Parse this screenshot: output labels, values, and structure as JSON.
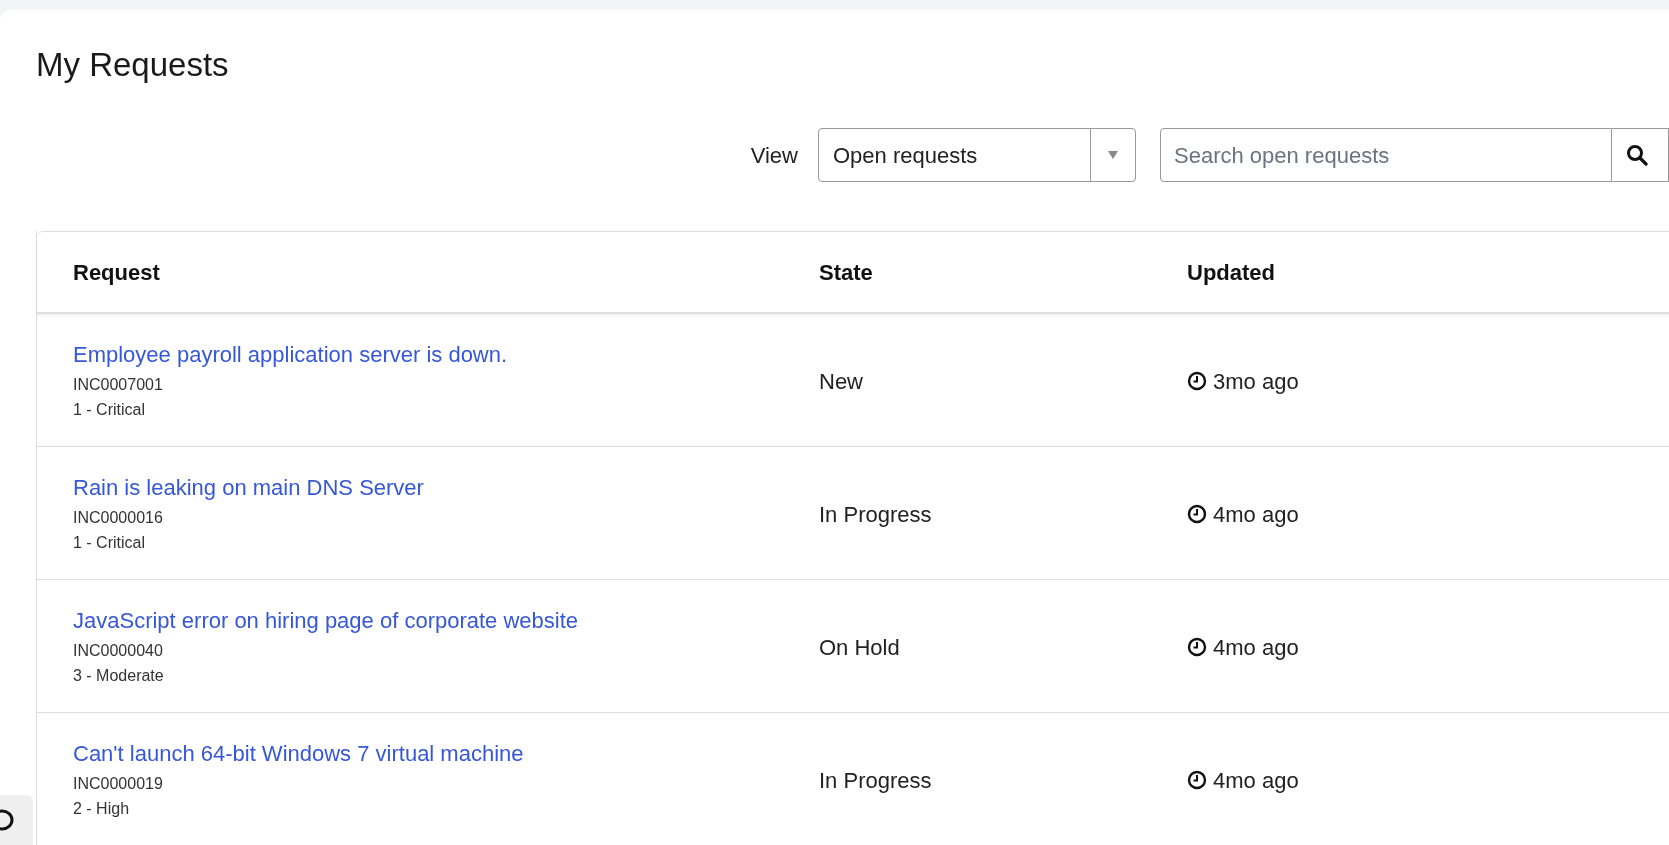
{
  "page": {
    "title": "My Requests"
  },
  "filters": {
    "view_label": "View",
    "view_value": "Open requests",
    "search_placeholder": "Search open requests"
  },
  "table": {
    "columns": [
      "Request",
      "State",
      "Updated"
    ],
    "rows": [
      {
        "title": "Employee payroll application server is down.",
        "number": "INC0007001",
        "priority": "1 - Critical",
        "state": "New",
        "updated": "3mo ago"
      },
      {
        "title": "Rain is leaking on main DNS Server",
        "number": "INC0000016",
        "priority": "1 - Critical",
        "state": "In Progress",
        "updated": "4mo ago"
      },
      {
        "title": "JavaScript error on hiring page of corporate website",
        "number": "INC0000040",
        "priority": "3 - Moderate",
        "state": "On Hold",
        "updated": "4mo ago"
      },
      {
        "title": "Can't launch 64-bit Windows 7 virtual machine",
        "number": "INC0000019",
        "priority": "2 - High",
        "state": "In Progress",
        "updated": "4mo ago"
      }
    ]
  }
}
